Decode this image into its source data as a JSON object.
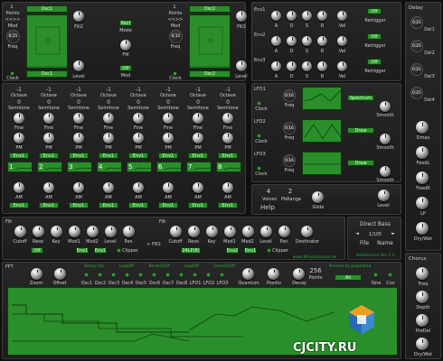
{
  "osc1": {
    "voice": "1",
    "points": "Points",
    "arrows": "<<>>",
    "mod": "Mod",
    "freq_value": "0.15",
    "freq": "Freq",
    "clock": "Clock",
    "top_name": "Osc1",
    "bottom_name": "Osc1",
    "fill2": "Fill2",
    "level": "Level",
    "fm": "FM"
  },
  "osc2": {
    "voice": "1",
    "points": "Points",
    "arrows": "<<>>",
    "mod": "Mod",
    "freq_value": "0.15",
    "freq": "Freq",
    "clock": "Clock",
    "top_name": "Osc2",
    "bottom_name": "Osc2",
    "fill2": "Fill2",
    "level": "Level"
  },
  "osc_middle": {
    "wave": "Rect",
    "mode": "Mode",
    "fm": "FM",
    "state": "Off",
    "mod": "Mod"
  },
  "envs": [
    {
      "name": "Env1",
      "knobs": [
        "A",
        "D",
        "S",
        "R"
      ],
      "vel": "Vel",
      "state": "Off",
      "retrigger": "Retrigger"
    },
    {
      "name": "Env2",
      "knobs": [
        "A",
        "D",
        "S",
        "R"
      ],
      "vel": "Vel",
      "state": "Off",
      "retrigger": "Retrigger"
    },
    {
      "name": "Env3",
      "knobs": [
        "A",
        "D",
        "S",
        "R"
      ],
      "vel": "Vel",
      "state": "Off",
      "retrigger": "Retrigger"
    }
  ],
  "lfos": [
    {
      "name": "LFO1",
      "freq_value": "0.16",
      "freq": "Freq",
      "clock": "Clock",
      "mode": "Spectrum",
      "smooth": "Smooth"
    },
    {
      "name": "LFO2",
      "freq_value": "0.16",
      "freq": "Freq",
      "clock": "Clock",
      "mode": "Draw",
      "smooth": "Smooth"
    },
    {
      "name": "LFO3",
      "freq_value": "0.16",
      "freq": "Freq",
      "clock": "Clock",
      "mode": "Draw",
      "smooth": "Smooth"
    }
  ],
  "voices": {
    "voices_value": "4",
    "voices": "Voices",
    "pb_value": "2",
    "pbrange": "PbRange",
    "help": "Help",
    "glide": "Glide",
    "level": "Level"
  },
  "partials": [
    {
      "value": "-1",
      "octave": "Octave",
      "semi_value": "0",
      "semitone": "Semitone",
      "fine": "Fine",
      "pm": "PM",
      "env": "Env1",
      "num": "1",
      "am": "AM"
    },
    {
      "value": "-1",
      "octave": "Octave",
      "semi_value": "0",
      "semitone": "Semitone",
      "fine": "Fine",
      "pm": "PM",
      "env": "Env1",
      "num": "2",
      "am": "AM"
    },
    {
      "value": "-1",
      "octave": "Octave",
      "semi_value": "0",
      "semitone": "Semitone",
      "fine": "Fine",
      "pm": "PM",
      "env": "Env1",
      "num": "3",
      "am": "AM"
    },
    {
      "value": "-1",
      "octave": "Octave",
      "semi_value": "0",
      "semitone": "Semitone",
      "fine": "Fine",
      "pm": "PM",
      "env": "Env1",
      "num": "4",
      "am": "AM"
    },
    {
      "value": "-1",
      "octave": "Octave",
      "semi_value": "0",
      "semitone": "Semitone",
      "fine": "Fine",
      "pm": "PM",
      "env": "Env1",
      "num": "5",
      "am": "AM"
    },
    {
      "value": "-1",
      "octave": "Octave",
      "semi_value": "0",
      "semitone": "Semitone",
      "fine": "Fine",
      "pm": "PM",
      "env": "Env1",
      "num": "6",
      "am": "AM"
    },
    {
      "value": "-1",
      "octave": "Octave",
      "semi_value": "0",
      "semitone": "Semitone",
      "fine": "Fine",
      "pm": "PM",
      "env": "Env1",
      "num": "7",
      "am": "AM"
    },
    {
      "value": "-1",
      "octave": "Octave",
      "semi_value": "0",
      "semitone": "Semitone",
      "fine": "Fine",
      "pm": "PM",
      "env": "Env1",
      "num": "8",
      "am": "AM"
    }
  ],
  "filters": {
    "f1": {
      "label": "Filt",
      "knobs": [
        "Cutoff",
        "Reso",
        "Key",
        "Mod1",
        "Mod2",
        "Level",
        "Pan"
      ],
      "off": "Off",
      "env": "Env1",
      "env2": "Env1",
      "clipper": "Clipper"
    },
    "f2": {
      "label": "Filt",
      "knobs": [
        "Cutoff",
        "Reso",
        "Key",
        "Mod1",
        "Mod2",
        "Level",
        "Pan"
      ],
      "mode": "24LP(8)",
      "env": "Env2",
      "env2": "Env1",
      "clipper": "Clipper"
    },
    "fill2": "> Fill2",
    "destination": "Destinator"
  },
  "preset": {
    "name": "Direct Bass",
    "counter": "1/105",
    "file": "File",
    "name_label": "Name",
    "website": "www.MinuteSound.de",
    "version": "Addasound Ver 2.2"
  },
  "fft": {
    "title": "FFT",
    "knobs": [
      "Zoom",
      "Offset"
    ],
    "header_labels": [
      "Decay Osc",
      "LowDiff",
      "ReverbDiff",
      "LowDiff",
      "SmoothDiff"
    ],
    "sources": [
      "Osc1",
      "Osc2",
      "Osc3",
      "Osc4",
      "Osc5",
      "Osc6",
      "Osc7",
      "Osc8",
      "LFO1",
      "LFO2",
      "LFO3"
    ],
    "quantum": "Quantum",
    "position": "Positiv",
    "decay": "Decay",
    "points_value": "256",
    "points": "Points",
    "mode_title": "Prevent be populated",
    "mode": "All",
    "sine": "Sine",
    "cos": "Cos"
  },
  "delay": {
    "title": "Delay",
    "items": [
      {
        "value": "0.21",
        "label": "Del1"
      },
      {
        "value": "0.25",
        "label": "Del2"
      },
      {
        "value": "0.21",
        "label": "Del3"
      },
      {
        "value": "0.25",
        "label": "Del4"
      }
    ],
    "knobs": [
      "Dmax",
      "FeedL",
      "FeedR",
      "LP",
      "Dry/Wet"
    ]
  },
  "chorus": {
    "title": "Chorus",
    "knobs": [
      "Freq",
      "Depth",
      "PreDel",
      "Dry/Wet"
    ]
  },
  "watermark": "CJCITY.RU"
}
